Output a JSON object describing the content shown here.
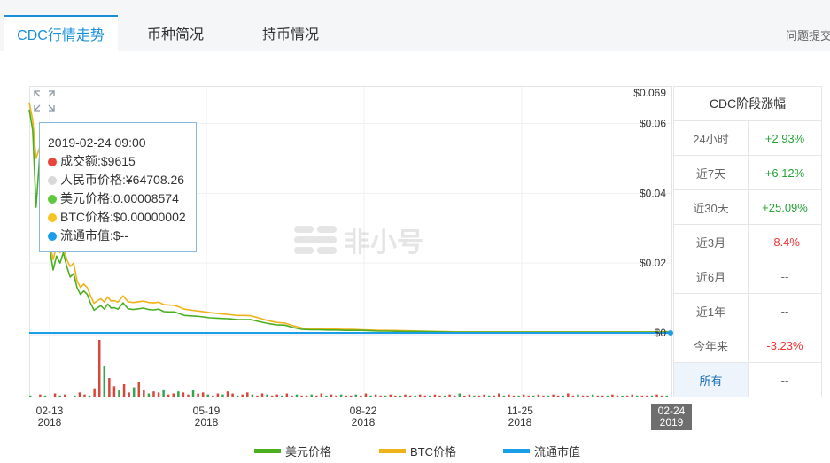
{
  "tabs": [
    {
      "label": "CDC行情走势",
      "active": true
    },
    {
      "label": "币种简况",
      "active": false
    },
    {
      "label": "持币情况",
      "active": false
    }
  ],
  "feedback_label": "问题提交",
  "watermark": "非小号",
  "tooltip": {
    "date": "2019-02-24 09:00",
    "rows": [
      {
        "label": "成交额:$9615",
        "color": "#e8453c"
      },
      {
        "label": "人民币价格:¥64708.26",
        "color": "#d9d9d9"
      },
      {
        "label": "美元价格:0.00008574",
        "color": "#5cc93b"
      },
      {
        "label": "BTC价格:$0.00000002",
        "color": "#f7c325"
      },
      {
        "label": "流通市值:$--",
        "color": "#1a9ee8"
      }
    ]
  },
  "stats": {
    "title": "CDC阶段涨幅",
    "rows": [
      {
        "label": "24小时",
        "value": "+2.93%",
        "trend": "up"
      },
      {
        "label": "近7天",
        "value": "+6.12%",
        "trend": "up"
      },
      {
        "label": "近30天",
        "value": "+25.09%",
        "trend": "up"
      },
      {
        "label": "近3月",
        "value": "-8.4%",
        "trend": "down"
      },
      {
        "label": "近6月",
        "value": "--",
        "trend": "flat"
      },
      {
        "label": "近1年",
        "value": "--",
        "trend": "flat"
      },
      {
        "label": "今年来",
        "value": "-3.23%",
        "trend": "down"
      },
      {
        "label": "所有",
        "value": "--",
        "trend": "flat",
        "selected": true
      }
    ]
  },
  "chart_data": {
    "type": "line",
    "y_ticks": [
      "$0.069",
      "$0.06",
      "$0.04",
      "$0.02",
      "$0"
    ],
    "ylim": [
      0,
      0.069
    ],
    "x_ticks": [
      {
        "line1": "02-13",
        "line2": "2018"
      },
      {
        "line1": "05-19",
        "line2": "2018"
      },
      {
        "line1": "08-22",
        "line2": "2018"
      },
      {
        "line1": "11-25",
        "line2": "2018"
      },
      {
        "line1": "02-24",
        "line2": "2019"
      }
    ],
    "x": [
      0,
      2,
      4,
      6,
      8,
      10,
      12,
      14,
      16,
      18,
      20,
      22,
      24,
      26,
      28,
      30,
      32,
      34,
      36,
      38,
      40,
      42,
      44,
      46,
      48,
      50,
      52,
      55,
      58,
      61,
      64,
      67,
      70,
      73,
      76,
      79,
      82,
      85,
      88,
      91,
      94,
      97,
      100,
      103,
      106,
      110,
      114,
      118,
      122,
      126,
      130,
      135,
      140,
      145,
      150,
      155,
      160,
      165,
      170,
      175,
      180,
      185,
      190,
      195,
      200,
      205,
      210,
      220,
      230,
      240,
      250,
      260,
      270,
      280,
      290,
      300,
      310,
      320,
      330,
      340,
      350,
      360,
      370,
      376
    ],
    "series": [
      {
        "name": "美元价格",
        "color": "#4caf22",
        "values": [
          0.064,
          0.058,
          0.036,
          0.05,
          0.033,
          0.03,
          0.024,
          0.018,
          0.022,
          0.02,
          0.023,
          0.019,
          0.016,
          0.017,
          0.013,
          0.011,
          0.012,
          0.011,
          0.0085,
          0.0065,
          0.0072,
          0.0078,
          0.0068,
          0.0083,
          0.0071,
          0.0072,
          0.0068,
          0.0086,
          0.0069,
          0.0067,
          0.0069,
          0.0071,
          0.0067,
          0.0066,
          0.0068,
          0.0061,
          0.006,
          0.006,
          0.0055,
          0.005,
          0.0049,
          0.0048,
          0.0047,
          0.0045,
          0.0043,
          0.0042,
          0.0041,
          0.004,
          0.0038,
          0.0038,
          0.0038,
          0.0032,
          0.0027,
          0.0023,
          0.0022,
          0.0015,
          0.001,
          0.0009,
          0.0009,
          0.0008,
          0.0008,
          0.0007,
          0.0007,
          0.0007,
          0.0006,
          0.0005,
          0.0005,
          0.0004,
          0.0004,
          0.0003,
          0.0002,
          0.0002,
          0.0002,
          0.0002,
          0.0002,
          0.0002,
          0.0002,
          0.0002,
          0.0002,
          0.0002,
          0.0002,
          0.0002,
          0.0002,
          0.0003
        ]
      },
      {
        "name": "BTC价格",
        "color": "#f0b21a",
        "values": [
          0.066,
          0.061,
          0.05,
          0.053,
          0.036,
          0.032,
          0.026,
          0.021,
          0.025,
          0.023,
          0.025,
          0.021,
          0.019,
          0.02,
          0.015,
          0.013,
          0.014,
          0.013,
          0.0105,
          0.0085,
          0.0092,
          0.0098,
          0.0088,
          0.0103,
          0.0091,
          0.0092,
          0.0088,
          0.0106,
          0.0089,
          0.0087,
          0.0089,
          0.0091,
          0.0087,
          0.0086,
          0.0088,
          0.0081,
          0.008,
          0.0079,
          0.0074,
          0.0068,
          0.0066,
          0.0064,
          0.0062,
          0.006,
          0.0058,
          0.0056,
          0.0054,
          0.0052,
          0.005,
          0.005,
          0.0049,
          0.0042,
          0.0035,
          0.003,
          0.0028,
          0.002,
          0.0014,
          0.0012,
          0.0012,
          0.0011,
          0.0011,
          0.001,
          0.001,
          0.0009,
          0.0008,
          0.0007,
          0.0007,
          0.0006,
          0.0005,
          0.0004,
          0.0003,
          0.0003,
          0.0003,
          0.0003,
          0.0003,
          0.0003,
          0.0003,
          0.0003,
          0.0003,
          0.0003,
          0.0003,
          0.0003,
          0.0003,
          0.0004
        ]
      },
      {
        "name": "流通市值",
        "color": "#1a9ee8",
        "values": [
          0,
          0,
          0,
          0,
          0,
          0,
          0,
          0,
          0,
          0,
          0,
          0,
          0,
          0,
          0,
          0,
          0,
          0,
          0,
          0,
          0,
          0,
          0,
          0,
          0,
          0,
          0,
          0,
          0,
          0,
          0,
          0,
          0,
          0,
          0,
          0,
          0,
          0,
          0,
          0,
          0,
          0,
          0,
          0,
          0,
          0,
          0,
          0,
          0,
          0,
          0,
          0,
          0,
          0,
          0,
          0,
          0,
          0,
          0,
          0,
          0,
          0,
          0,
          0,
          0,
          0,
          0,
          0,
          0,
          0,
          0,
          0,
          0,
          0,
          0,
          0,
          0,
          0,
          0,
          0,
          0,
          0,
          0,
          0
        ]
      }
    ],
    "volume": {
      "name": "成交额",
      "values": [
        1,
        0,
        2,
        1,
        0,
        3,
        1,
        2,
        0,
        1,
        4,
        2,
        1,
        8,
        55,
        30,
        18,
        10,
        6,
        12,
        4,
        9,
        14,
        6,
        3,
        5,
        4,
        7,
        2,
        3,
        5,
        4,
        2,
        6,
        3,
        4,
        2,
        1,
        3,
        2,
        5,
        3,
        1,
        2,
        4,
        2,
        1,
        3,
        2,
        1,
        2,
        1,
        3,
        1,
        2,
        1,
        1,
        2,
        1,
        3,
        1,
        2,
        1,
        2,
        1,
        1,
        2,
        1,
        3,
        1,
        2,
        1,
        1,
        2,
        1,
        1,
        2,
        1,
        1,
        2,
        1,
        1,
        2,
        1,
        1,
        2,
        1,
        3,
        1,
        2,
        1,
        1,
        2,
        1,
        1,
        3,
        1,
        2,
        1,
        1,
        2,
        1,
        1,
        2,
        1,
        1,
        2,
        1,
        1,
        3,
        1,
        2,
        1,
        1,
        2,
        1,
        1,
        1,
        2,
        1,
        1,
        1,
        2,
        1,
        1,
        1,
        1,
        2,
        1,
        1
      ]
    }
  }
}
